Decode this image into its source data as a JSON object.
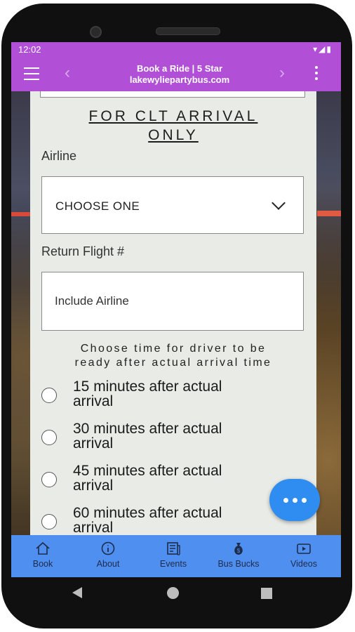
{
  "status_bar": {
    "time": "12:02",
    "icons": [
      "wifi-icon",
      "signal-icon",
      "battery-icon"
    ]
  },
  "app_bar": {
    "title_line1": "Book a Ride | 5 Star",
    "title_line2": "lakewyliepartybus.com",
    "back_glyph": "‹",
    "forward_glyph": "›",
    "color": "#b14fd6"
  },
  "form": {
    "heading_line1": "FOR CLT ARRIVAL",
    "heading_line2": "ONLY",
    "airline_label": "Airline",
    "airline_selected": "CHOOSE ONE",
    "return_flight_label": "Return Flight #",
    "return_flight_placeholder": "Include Airline",
    "instructions_line1": "Choose time for driver to be",
    "instructions_line2": "ready after actual arrival time",
    "options": [
      {
        "line1": "15 minutes after actual",
        "line2": "arrival"
      },
      {
        "line1": "30 minutes after actual",
        "line2": "arrival"
      },
      {
        "line1": "45 minutes after actual",
        "line2": "arrival"
      },
      {
        "line1": "60 minutes after actual",
        "line2": "arrival"
      }
    ]
  },
  "bottom_nav": {
    "color": "#4f8ff0",
    "items": [
      {
        "label": "Book",
        "icon": "home-icon"
      },
      {
        "label": "About",
        "icon": "info-icon"
      },
      {
        "label": "Events",
        "icon": "newspaper-icon"
      },
      {
        "label": "Bus Bucks",
        "icon": "money-bag-icon"
      },
      {
        "label": "Videos",
        "icon": "video-icon"
      }
    ]
  },
  "fab": {
    "icon": "more-horizontal-icon",
    "color": "#2f8cf0"
  }
}
